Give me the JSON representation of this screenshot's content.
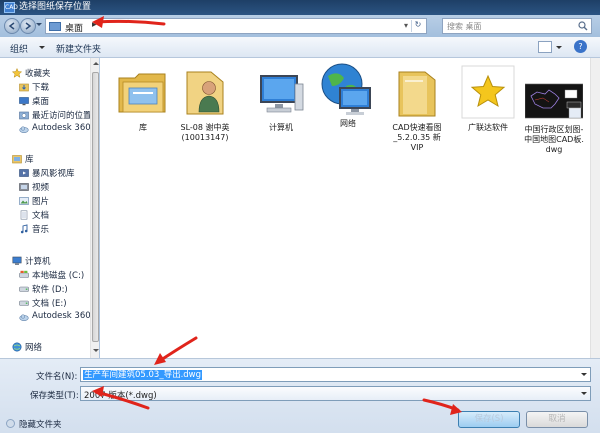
{
  "window": {
    "title": "选择图纸保存位置",
    "app_icon_text": "CAD"
  },
  "address": {
    "location": "桌面",
    "chevron": "▸",
    "dropdown_glyph": "▾",
    "refresh_glyph": "↻"
  },
  "search": {
    "placeholder": "搜索 桌面"
  },
  "toolbar": {
    "organize_label": "组织",
    "new_folder_label": "新建文件夹",
    "help_glyph": "?"
  },
  "sidebar": {
    "groups": [
      {
        "label": "收藏夹",
        "icon": "star-icon",
        "items": [
          {
            "label": "下载",
            "icon": "download-folder-icon"
          },
          {
            "label": "桌面",
            "icon": "desktop-icon"
          },
          {
            "label": "最近访问的位置",
            "icon": "recent-places-icon"
          },
          {
            "label": "Autodesk 360",
            "icon": "cloud-icon"
          }
        ]
      },
      {
        "label": "库",
        "icon": "library-icon",
        "items": [
          {
            "label": "暴风影视库",
            "icon": "video-library-icon"
          },
          {
            "label": "视频",
            "icon": "video-icon"
          },
          {
            "label": "图片",
            "icon": "pictures-icon"
          },
          {
            "label": "文档",
            "icon": "documents-icon"
          },
          {
            "label": "音乐",
            "icon": "music-icon"
          }
        ]
      },
      {
        "label": "计算机",
        "icon": "computer-icon",
        "items": [
          {
            "label": "本地磁盘 (C:)",
            "icon": "drive-icon"
          },
          {
            "label": "软件 (D:)",
            "icon": "drive-icon"
          },
          {
            "label": "文档 (E:)",
            "icon": "drive-icon"
          },
          {
            "label": "Autodesk 360",
            "icon": "cloud-icon"
          }
        ]
      },
      {
        "label": "网络",
        "icon": "network-icon",
        "items": []
      }
    ]
  },
  "files": [
    {
      "label": "库",
      "icon": "library-folder-icon"
    },
    {
      "label": "SL-08  谢中英\n(10013147)",
      "icon": "user-folder-icon"
    },
    {
      "label": "计算机",
      "icon": "computer-icon"
    },
    {
      "label": "网络",
      "icon": "network-globe-icon"
    },
    {
      "label": "CAD快速看图\n_5.2.0.35 新 VIP",
      "icon": "folder-icon"
    },
    {
      "label": "广联达软件",
      "icon": "star-shortcut-icon"
    },
    {
      "label": "中国行政区划图-\n中国地图CAD板.\ndwg",
      "icon": "dwg-thumbnail-icon"
    }
  ],
  "form": {
    "filename_label": "文件名(N):",
    "filename_value": "生产车间建筑05.03_导出.dwg",
    "filetype_label": "保存类型(T):",
    "filetype_value": "2007 版本(*.dwg)",
    "hide_folders_label": "隐藏文件夹",
    "save_label": "保存(S)",
    "cancel_label": "取消"
  },
  "colors": {
    "annotation_red": "#e0241b",
    "selection_blue": "#3399ff"
  }
}
